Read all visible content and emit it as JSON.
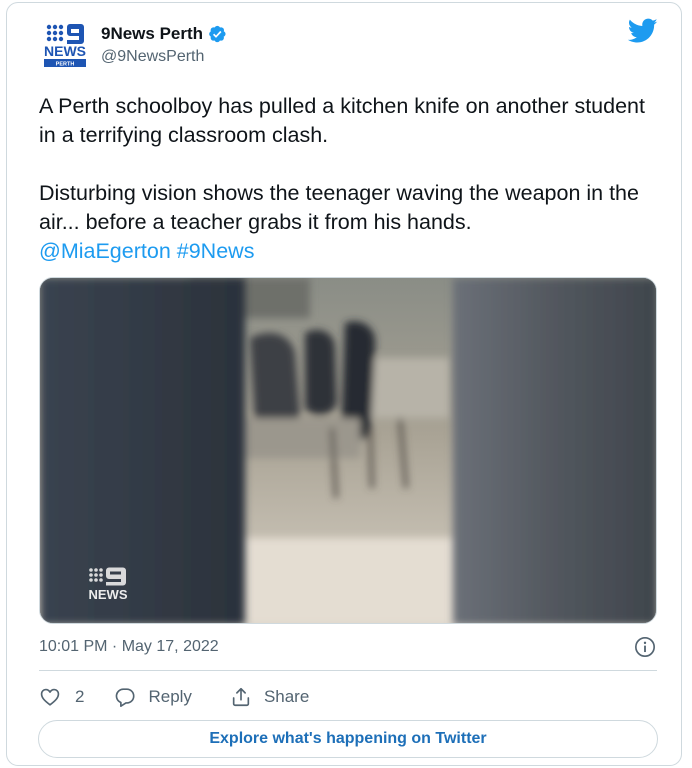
{
  "tweet": {
    "display_name": "9News Perth",
    "handle": "@9NewsPerth",
    "verified": true,
    "text_paragraph_1": "A Perth schoolboy has pulled a kitchen knife on another student in a terrifying classroom clash.",
    "text_paragraph_2": "Disturbing vision shows the teenager waving the weapon in the air... before a teacher grabs it from his hands.",
    "mention": "@MiaEgerton",
    "hashtag": "#9News",
    "timestamp": "10:01 PM · May 17, 2022",
    "like_count": "2",
    "reply_label": "Reply",
    "share_label": "Share",
    "explore_label": "Explore what's happening on Twitter"
  },
  "logo": {
    "top": "9",
    "middle": "NEWS",
    "bottom": "PERTH"
  },
  "video_watermark": {
    "top": "9",
    "bottom": "NEWS"
  },
  "colors": {
    "accent": "#1d9bf0",
    "text_secondary": "#536471",
    "border": "#cfd9de",
    "brand_blue": "#1e55b3"
  },
  "icons": {
    "verified": "verified-badge-icon",
    "platform": "twitter-bird-icon",
    "info": "info-icon",
    "like": "heart-icon",
    "reply": "reply-bubble-icon",
    "share": "share-icon"
  }
}
